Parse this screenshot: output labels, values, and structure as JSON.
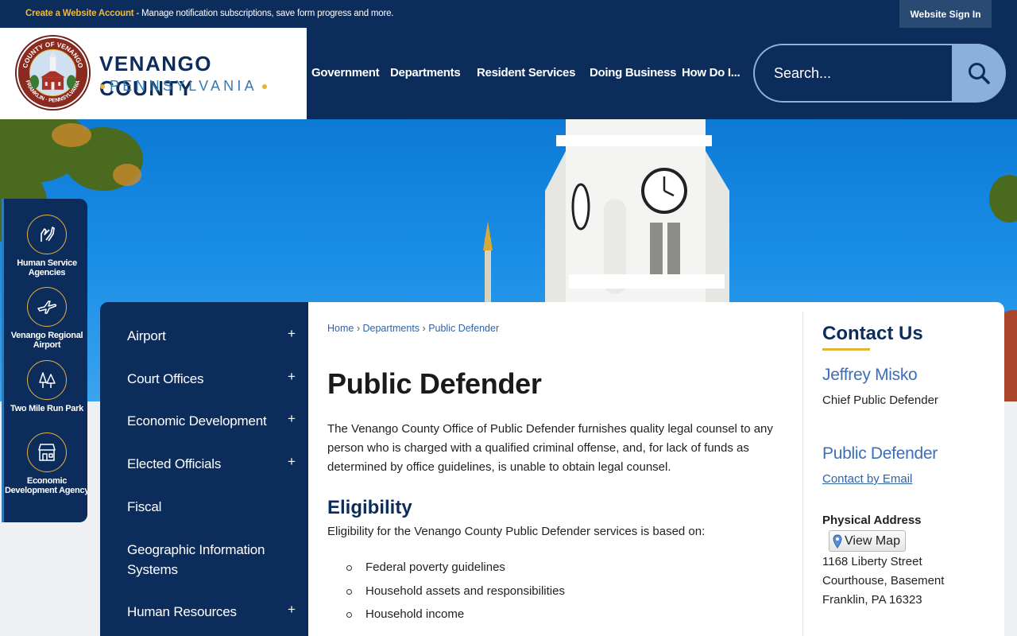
{
  "topbar": {
    "create_link": "Create a Website Account",
    "message": " - Manage notification subscriptions, save form progress and more.",
    "signin": "Website Sign In"
  },
  "logo": {
    "title": "VENANGO COUNTY",
    "subtitle": "PENNSYLVANIA",
    "seal_top": "COUNTY OF VENANGO",
    "seal_bottom": "FRANKLIN · PENNSYLVANIA"
  },
  "nav": [
    "Government",
    "Departments",
    "Resident Services",
    "Doing Business",
    "How Do I..."
  ],
  "search": {
    "placeholder": "Search..."
  },
  "quick_links": [
    {
      "label": "Human Service Agencies",
      "icon": "hands-icon"
    },
    {
      "label": "Venango Regional Airport",
      "icon": "airplane-icon"
    },
    {
      "label": "Two Mile Run Park",
      "icon": "trees-icon"
    },
    {
      "label": "Economic Development Agency",
      "icon": "storefront-icon"
    }
  ],
  "sidebar": [
    {
      "label": "Airport",
      "expand": "+"
    },
    {
      "label": "Court Offices",
      "expand": "+"
    },
    {
      "label": "Economic Development",
      "expand": "+"
    },
    {
      "label": "Elected Officials",
      "expand": "+"
    },
    {
      "label": "Fiscal",
      "expand": ""
    },
    {
      "label": "Geographic Information Systems",
      "expand": ""
    },
    {
      "label": "Human Resources",
      "expand": "+"
    }
  ],
  "breadcrumb": [
    "Home",
    "Departments",
    "Public Defender"
  ],
  "page": {
    "title": "Public Defender",
    "intro": "The Venango County Office of Public Defender furnishes quality legal counsel to any person who is charged with a qualified criminal offense, and, for lack of funds as determined by office guidelines, is unable to obtain legal counsel.",
    "eligibility_heading": "Eligibility",
    "eligibility_text": "Eligibility for the Venango County Public Defender services is based on:",
    "eligibility_items": [
      "Federal poverty guidelines",
      "Household assets and responsibilities",
      "Household income"
    ]
  },
  "contact": {
    "title": "Contact Us",
    "name": "Jeffrey Misko",
    "role": "Chief Public Defender",
    "department": "Public Defender",
    "email_link": "Contact by Email",
    "address_label": "Physical Address",
    "view_map": "View Map",
    "address": [
      "1168 Liberty Street",
      "Courthouse, Basement",
      "Franklin, PA 16323"
    ]
  },
  "colors": {
    "navy": "#0c2d5c",
    "gold": "#e5b23a",
    "link": "#2f63a6"
  }
}
